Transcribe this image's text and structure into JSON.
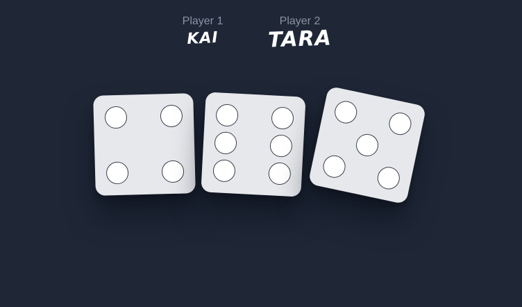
{
  "players": [
    {
      "label": "Player 1",
      "name": "KAI"
    },
    {
      "label": "Player 2",
      "name": "TARA"
    }
  ],
  "dice": [
    {
      "value": 4
    },
    {
      "value": 6
    },
    {
      "value": 5
    }
  ],
  "colors": {
    "background": "#1f2737",
    "die_face": "#e7e8ec",
    "pip": "#ffffff",
    "pip_border": "#3a3f4a",
    "label": "#8a93a3",
    "name": "#ffffff"
  }
}
